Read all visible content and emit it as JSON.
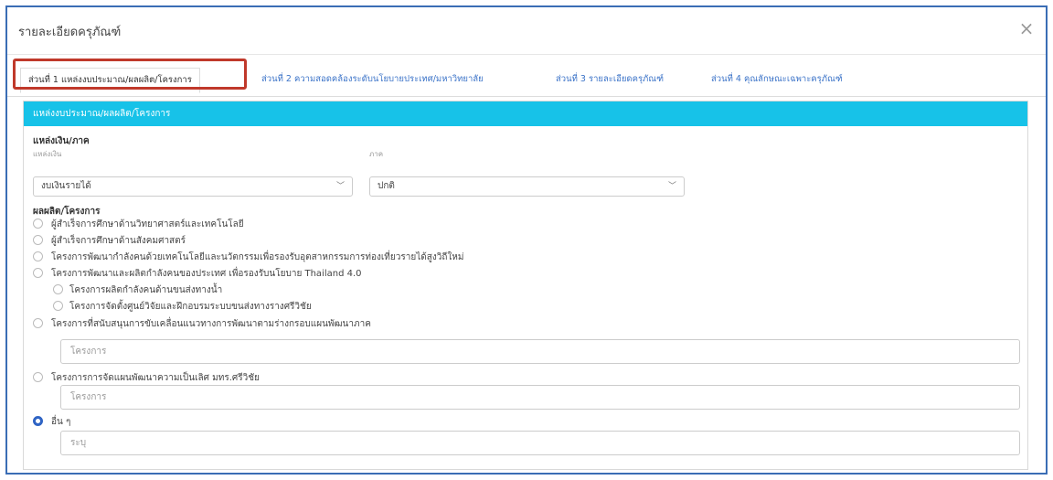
{
  "modal": {
    "title": "รายละเอียดครุภัณฑ์",
    "close_symbol": "×"
  },
  "tabs": [
    {
      "label": "ส่วนที่ 1 แหล่งงบประมาณ/ผลผลิต/โครงการ"
    },
    {
      "label": "ส่วนที่ 2 ความสอดคล้องระดับนโยบายประเทศ/มหาวิทยาลัย"
    },
    {
      "label": "ส่วนที่ 3 รายละเอียดครุภัณฑ์"
    },
    {
      "label": "ส่วนที่ 4 คุณลักษณะเฉพาะครุภัณฑ์"
    }
  ],
  "panel": {
    "header": "แหล่งงบประมาณ/ผลผลิต/โครงการ"
  },
  "funding": {
    "section_label": "แหล่งเงิน/ภาค",
    "source_label": "แหล่งเงิน",
    "source_value": "งบเงินรายได้",
    "sector_label": "ภาค",
    "sector_value": "ปกติ"
  },
  "products": {
    "section_label": "ผลผลิต/โครงการ",
    "options": [
      {
        "label": "ผู้สำเร็จการศึกษาด้านวิทยาศาสตร์และเทคโนโลยี"
      },
      {
        "label": "ผู้สำเร็จการศึกษาด้านสังคมศาสตร์"
      },
      {
        "label": "โครงการพัฒนากำลังคนด้วยเทคโนโลยีและนวัตกรรมเพื่อรองรับอุตสาหกรรมการท่องเที่ยวรายได้สูงวิถีใหม่"
      },
      {
        "label": "โครงการพัฒนาและผลิตกำลังคนของประเทศ เพื่อรองรับนโยบาย Thailand 4.0"
      },
      {
        "label": "โครงการผลิตกำลังคนด้านขนส่งทางน้ำ"
      },
      {
        "label": "โครงการจัดตั้งศูนย์วิจัยและฝึกอบรมระบบขนส่งทางรางศรีวิชัย"
      },
      {
        "label": "โครงการที่สนับสนุนการขับเคลื่อนแนวทางการพัฒนาตามร่างกรอบแผนพัฒนาภาค"
      },
      {
        "label": "โครงการการจัดแผนพัฒนาความเป็นเลิศ มทร.ศรีวิชัย"
      },
      {
        "label": "อื่น ๆ"
      }
    ],
    "placeholder_project": "โครงการ",
    "placeholder_specify": "ระบุ"
  }
}
